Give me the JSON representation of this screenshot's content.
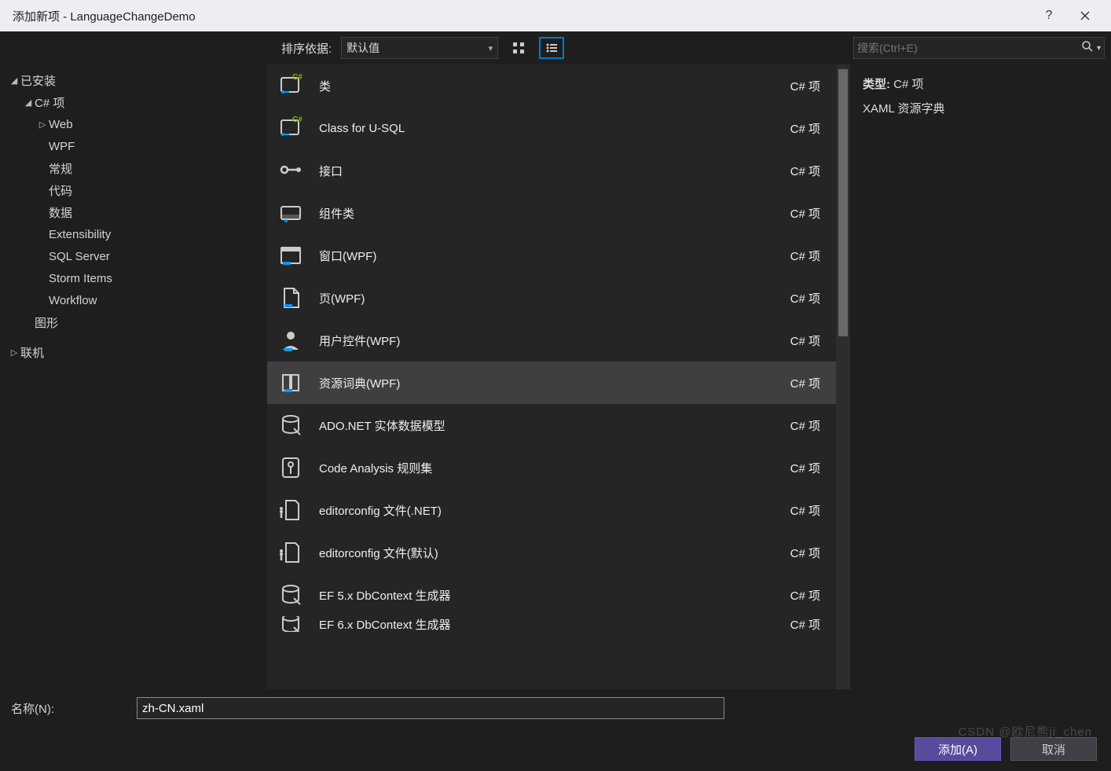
{
  "window": {
    "title": "添加新项 - LanguageChangeDemo"
  },
  "toolbar": {
    "sort_label": "排序依据:",
    "sort_value": "默认值",
    "search_placeholder": "搜索(Ctrl+E)"
  },
  "tree": {
    "installed": "已安装",
    "csharp_items": "C# 项",
    "children": [
      "Web",
      "WPF",
      "常规",
      "代码",
      "数据",
      "Extensibility",
      "SQL Server",
      "Storm Items",
      "Workflow"
    ],
    "graphic": "图形",
    "online": "联机"
  },
  "templates": [
    {
      "name": "类",
      "tag": "C# 项",
      "icon": "class"
    },
    {
      "name": "Class for U-SQL",
      "tag": "C# 项",
      "icon": "class"
    },
    {
      "name": "接口",
      "tag": "C# 项",
      "icon": "interface"
    },
    {
      "name": "组件类",
      "tag": "C# 项",
      "icon": "component"
    },
    {
      "name": "窗口(WPF)",
      "tag": "C# 项",
      "icon": "window"
    },
    {
      "name": "页(WPF)",
      "tag": "C# 项",
      "icon": "page"
    },
    {
      "name": "用户控件(WPF)",
      "tag": "C# 项",
      "icon": "user"
    },
    {
      "name": "资源词典(WPF)",
      "tag": "C# 项",
      "icon": "dictionary",
      "selected": true
    },
    {
      "name": "ADO.NET 实体数据模型",
      "tag": "C# 项",
      "icon": "model"
    },
    {
      "name": "Code Analysis 规则集",
      "tag": "C# 项",
      "icon": "ruleset"
    },
    {
      "name": "editorconfig 文件(.NET)",
      "tag": "C# 项",
      "icon": "config"
    },
    {
      "name": "editorconfig 文件(默认)",
      "tag": "C# 项",
      "icon": "config"
    },
    {
      "name": "EF 5.x DbContext 生成器",
      "tag": "C# 项",
      "icon": "model"
    },
    {
      "name": "EF 6.x DbContext 生成器",
      "tag": "C# 项",
      "icon": "model"
    }
  ],
  "detail": {
    "type_label": "类型:",
    "type_value": "C# 项",
    "description": "XAML 资源字典"
  },
  "nameRow": {
    "label": "名称(N):",
    "value": "zh-CN.xaml"
  },
  "buttons": {
    "add": "添加(A)",
    "cancel": "取消"
  },
  "watermark": "CSDN @欧尼熊ji_chen"
}
